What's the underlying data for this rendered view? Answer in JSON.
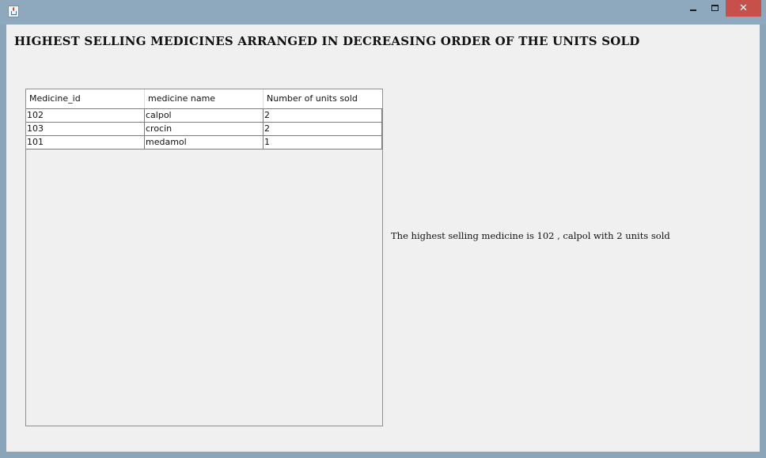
{
  "window": {
    "close_symbol": "✕"
  },
  "heading": "HIGHEST SELLING MEDICINES ARRANGED IN DECREASING ORDER OF THE UNITS SOLD",
  "table": {
    "columns": [
      "Medicine_id",
      "medicine name",
      "Number of units sold"
    ],
    "rows": [
      {
        "id": "102",
        "name": "calpol",
        "units": "2"
      },
      {
        "id": "103",
        "name": "crocin",
        "units": "2"
      },
      {
        "id": "101",
        "name": "medamol",
        "units": "1"
      }
    ]
  },
  "summary": "The highest selling medicine is 102 , calpol with 2 units sold",
  "icons": {
    "app": "java-icon",
    "minimize": "minimize-icon",
    "maximize": "maximize-icon",
    "close": "close-icon"
  },
  "colors": {
    "titlebar": "#8ea9bd",
    "close_button": "#c7504b",
    "client_background": "#f0f0f0"
  }
}
